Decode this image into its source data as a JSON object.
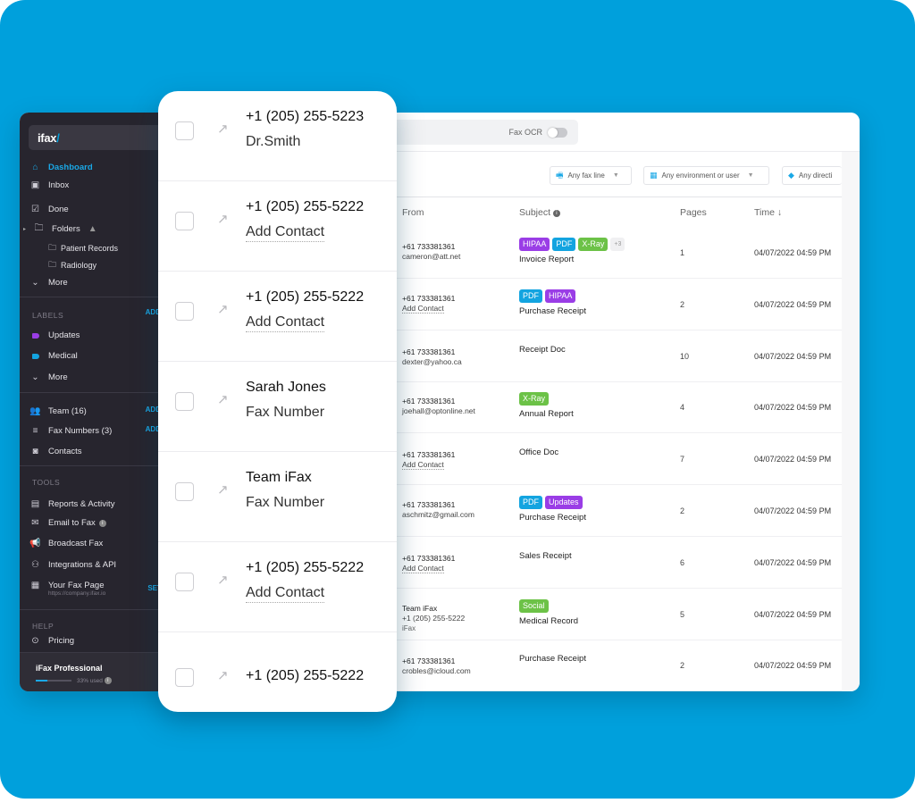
{
  "colors": {
    "background": "#00a0dc",
    "sidebar": "#27252e",
    "accent": "#1aa8e6",
    "hipaa": "#9a3de6",
    "pdf": "#13a4e0",
    "xray": "#6cc247",
    "updates": "#9a3de6",
    "social": "#6cc247"
  },
  "sidebar": {
    "logo": "ifax",
    "nav": [
      {
        "label": "Dashboard",
        "icon": "home-icon",
        "active": true
      },
      {
        "label": "Inbox",
        "icon": "inbox-icon"
      },
      {
        "label": "Done",
        "icon": "done-icon"
      },
      {
        "label": "Folders",
        "icon": "folder-icon"
      }
    ],
    "folders": [
      "Patient Records",
      "Radiology"
    ],
    "more1": "More",
    "labels_title": "LABELS",
    "labels_add": "ADD",
    "labels": [
      {
        "label": "Updates",
        "color": "#9a3de6"
      },
      {
        "label": "Medical",
        "color": "#13a4e0"
      }
    ],
    "more2": "More",
    "team": "Team (16)",
    "fax_numbers": "Fax Numbers (3)",
    "contacts": "Contacts",
    "add": "ADD",
    "tools_title": "TOOLS",
    "tools": [
      {
        "label": "Reports & Activity",
        "icon": "reports-icon"
      },
      {
        "label": "Email to Fax",
        "icon": "email-icon"
      },
      {
        "label": "Broadcast Fax",
        "icon": "broadcast-icon"
      },
      {
        "label": "Integrations &  API",
        "icon": "integrations-icon"
      },
      {
        "label": "Your Fax Page",
        "icon": "fax-page-icon"
      }
    ],
    "fax_page_url": "https://company.ifax.io",
    "fax_page_setup": "SETUP",
    "help_title": "HELP",
    "pricing": "Pricing",
    "plan": {
      "name": "iFax Professional",
      "used_label": "33% used",
      "used_percent": 33
    }
  },
  "toolbar": {
    "ocr_label": "Fax OCR",
    "ocr_enabled": false,
    "filters": [
      "Any fax line",
      "Any environment or user",
      "Any directi"
    ]
  },
  "table": {
    "headers": {
      "from": "From",
      "subject": "Subject",
      "pages": "Pages",
      "time": "Time ↓"
    },
    "rows": [
      {
        "from1": "+61 733381361",
        "from2": "cameron@att.net",
        "tags": [
          "HIPAA",
          "PDF",
          "X-Ray"
        ],
        "more": "+3",
        "subject": "Invoice Report",
        "pages": "1",
        "time": "04/07/2022 04:59 PM"
      },
      {
        "from1": "+61 733381361",
        "from2": "Add Contact",
        "tags": [
          "PDF",
          "HIPAA"
        ],
        "subject": "Purchase Receipt",
        "pages": "2",
        "time": "04/07/2022 04:59 PM"
      },
      {
        "from1": "+61 733381361",
        "from2": "dexter@yahoo.ca",
        "tags": [],
        "subject": "Receipt Doc",
        "pages": "10",
        "time": "04/07/2022 04:59 PM"
      },
      {
        "from1": "+61 733381361",
        "from2": "joehall@optonline.net",
        "tags": [
          "X-Ray"
        ],
        "subject": "Annual Report",
        "pages": "4",
        "time": "04/07/2022 04:59 PM"
      },
      {
        "from1": "+61 733381361",
        "from2": "Add Contact",
        "tags": [],
        "subject": "Office Doc",
        "pages": "7",
        "time": "04/07/2022 04:59 PM"
      },
      {
        "from1": "+61 733381361",
        "from2": "aschmitz@gmail.com",
        "tags": [
          "PDF",
          "Updates"
        ],
        "subject": "Purchase Receipt",
        "pages": "2",
        "time": "04/07/2022 04:59 PM"
      },
      {
        "from1": "+61 733381361",
        "from2": "Add Contact",
        "tags": [],
        "subject": "Sales Receipt",
        "pages": "6",
        "time": "04/07/2022 04:59 PM"
      },
      {
        "from1": "Team iFax",
        "from2": "+1 (205) 255-5222",
        "from3": "iFax",
        "tags": [
          "Social"
        ],
        "subject": "Medical Record",
        "pages": "5",
        "time": "04/07/2022 04:59 PM"
      },
      {
        "from1": "+61 733381361",
        "from2": "crobles@icloud.com",
        "tags": [],
        "subject": "Purchase Receipt",
        "pages": "2",
        "time": "04/07/2022 04:59 PM"
      }
    ]
  },
  "card": {
    "rows": [
      {
        "title": "+1 (205) 255-5223",
        "sub": "Dr.Smith",
        "dotted": false
      },
      {
        "title": "+1 (205) 255-5222",
        "sub": "Add Contact",
        "dotted": true
      },
      {
        "title": "+1 (205) 255-5222",
        "sub": "Add Contact",
        "dotted": true
      },
      {
        "title": "Sarah Jones",
        "sub": "Fax Number",
        "dotted": false
      },
      {
        "title": "Team iFax",
        "sub": "Fax Number",
        "dotted": false
      },
      {
        "title": "+1 (205) 255-5222",
        "sub": "Add Contact",
        "dotted": true
      },
      {
        "title": "+1 (205) 255-5222",
        "sub": "",
        "dotted": false
      }
    ]
  }
}
